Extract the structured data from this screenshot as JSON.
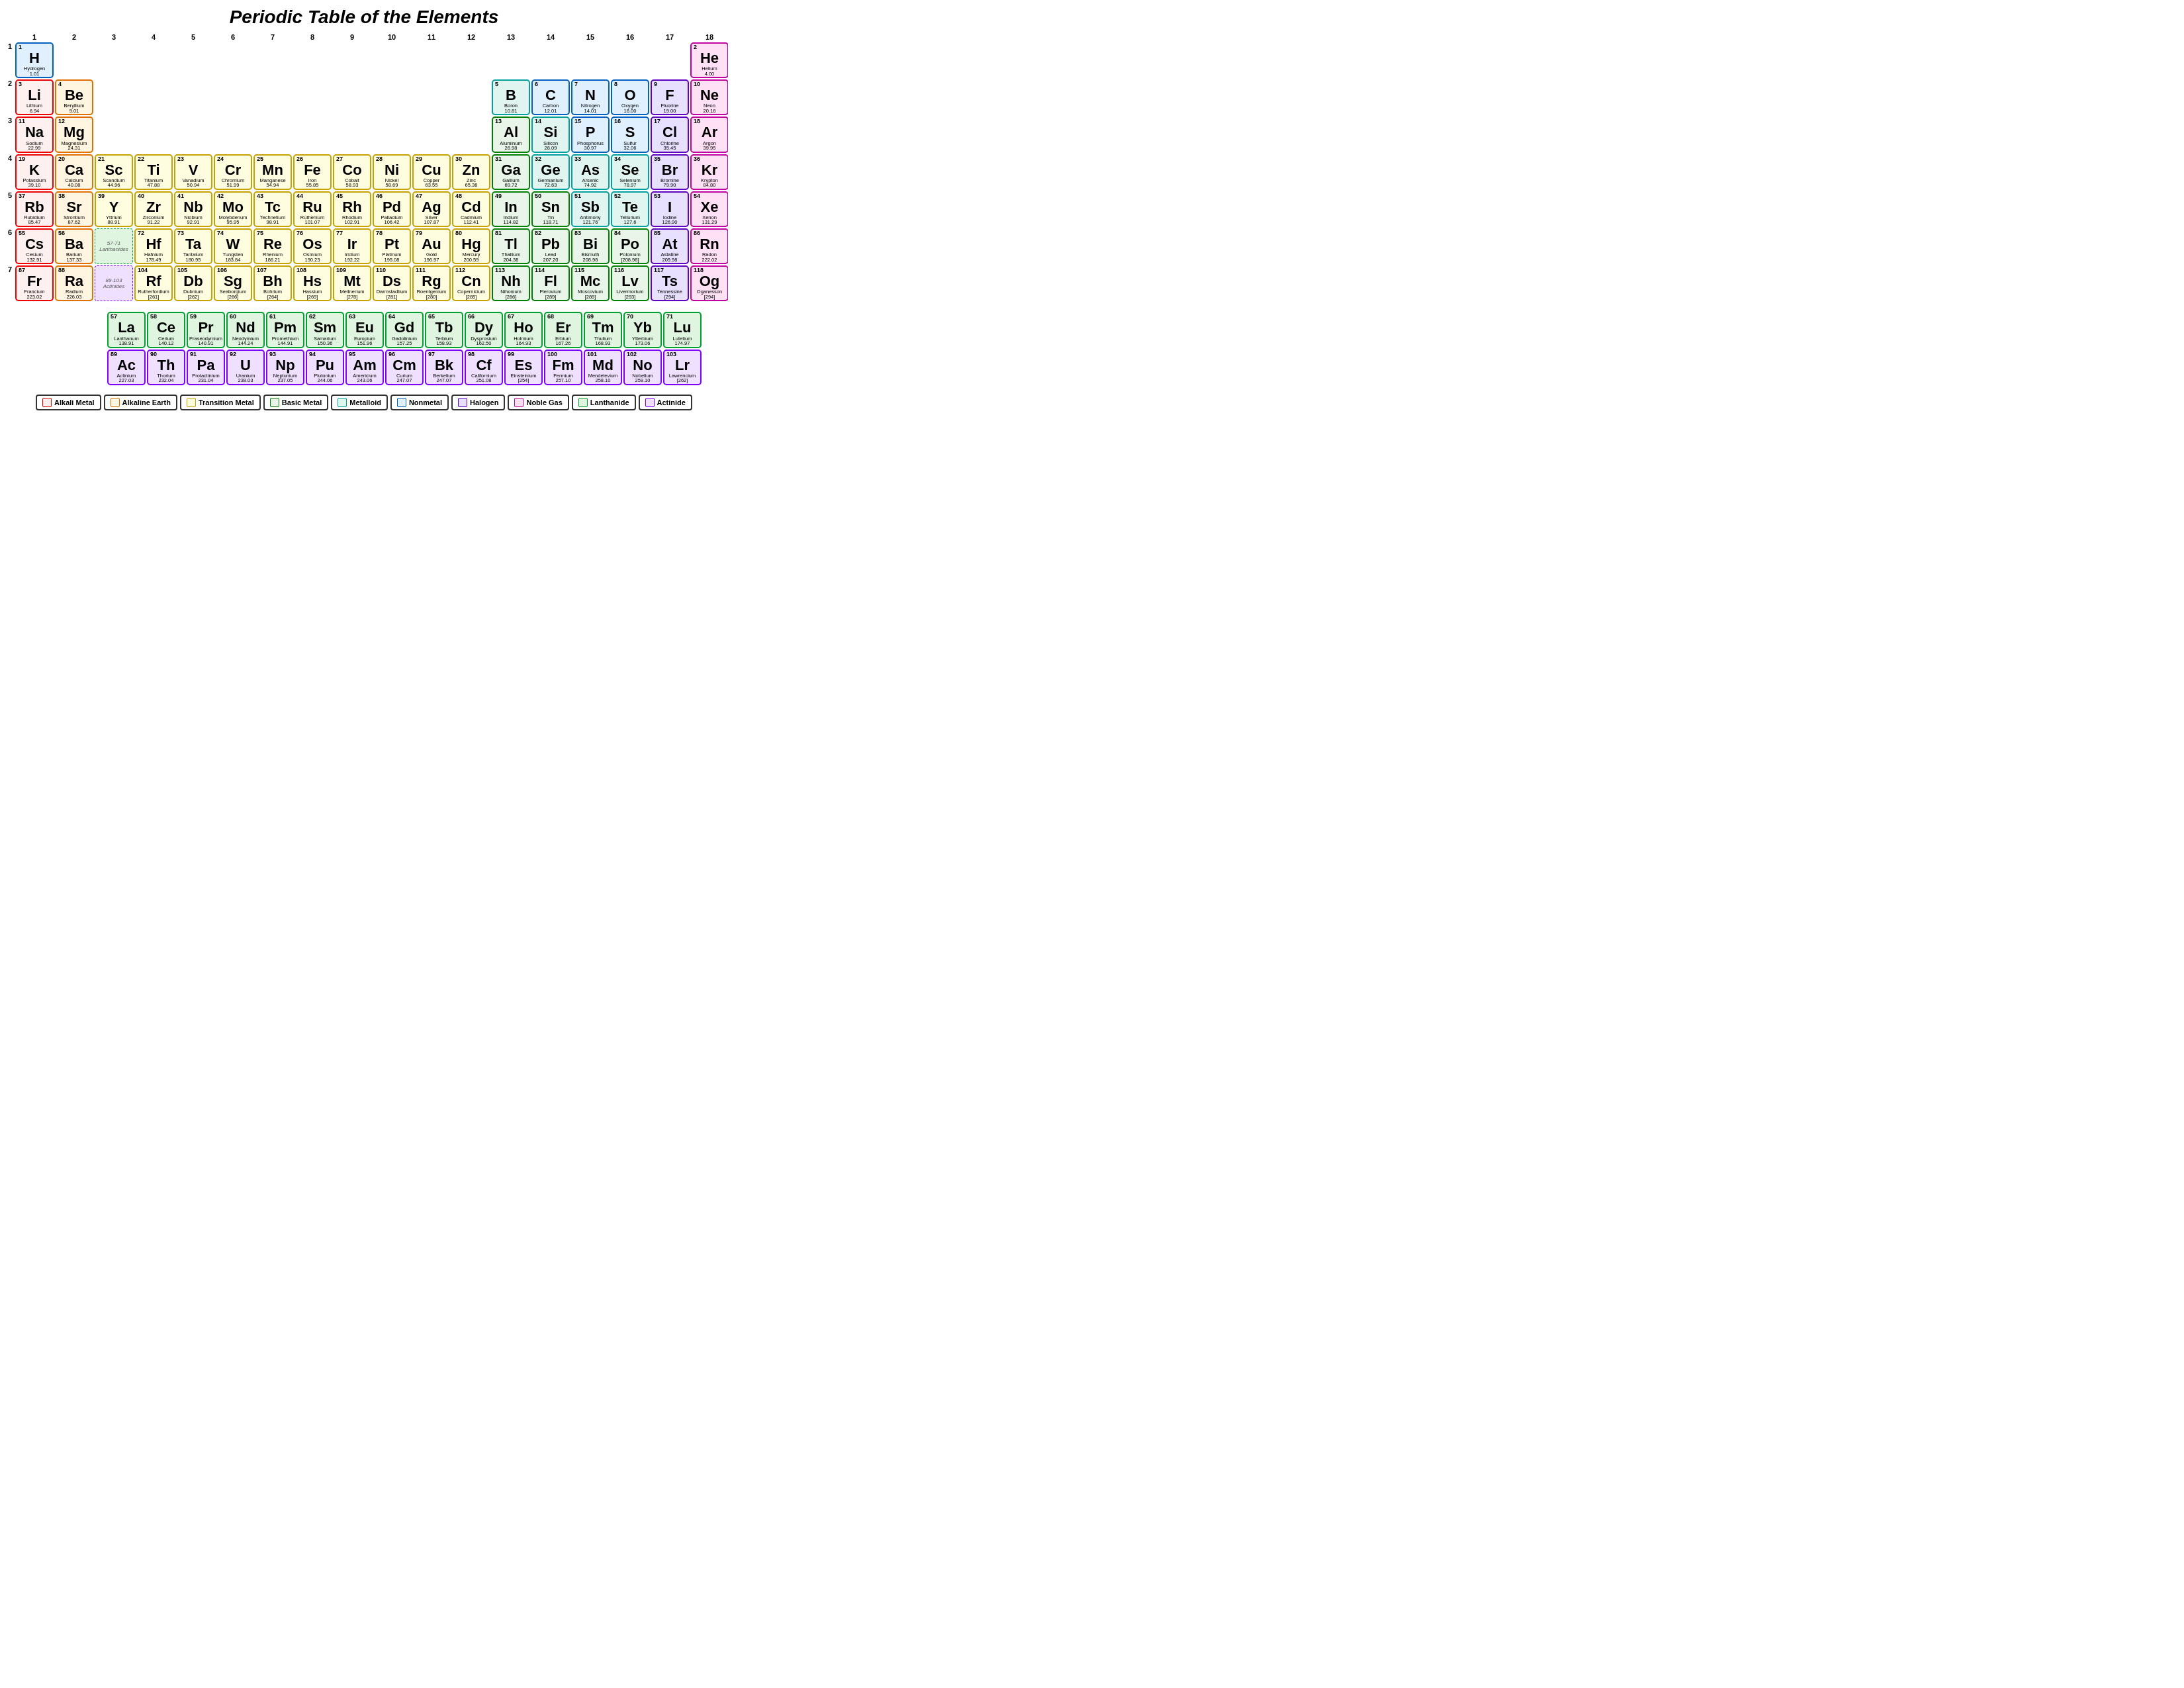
{
  "title": "Periodic Table of the Elements",
  "groups": [
    1,
    2,
    3,
    4,
    5,
    6,
    7,
    8,
    9,
    10,
    11,
    12,
    13,
    14,
    15,
    16,
    17,
    18
  ],
  "legend": [
    {
      "label": "Alkali Metal",
      "color": "#fff0f0",
      "border": "#e00000"
    },
    {
      "label": "Alkaline Earth",
      "color": "#fff5e0",
      "border": "#e07000"
    },
    {
      "label": "Transition Metal",
      "color": "#fffde0",
      "border": "#c8a000"
    },
    {
      "label": "Basic Metal",
      "color": "#e8f5e8",
      "border": "#008000"
    },
    {
      "label": "Metalloid",
      "color": "#e0f5f0",
      "border": "#00a0a0"
    },
    {
      "label": "Nonmetal",
      "color": "#e0f0ff",
      "border": "#0060c0"
    },
    {
      "label": "Halogen",
      "color": "#e8e0ff",
      "border": "#6000c0"
    },
    {
      "label": "Noble Gas",
      "color": "#ffe0f5",
      "border": "#c000a0"
    },
    {
      "label": "Lanthanide",
      "color": "#e0f5e0",
      "border": "#00a030"
    },
    {
      "label": "Actinide",
      "color": "#f0e0ff",
      "border": "#8000ff"
    }
  ]
}
